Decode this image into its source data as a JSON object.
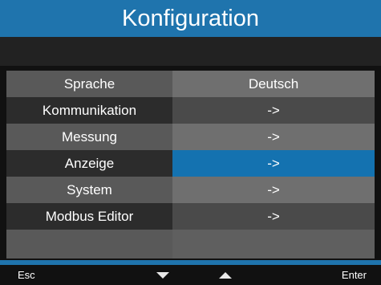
{
  "header": {
    "title": "Konfiguration"
  },
  "menu": {
    "items": [
      {
        "label": "Sprache",
        "value": "Deutsch"
      },
      {
        "label": "Kommunikation",
        "value": "->"
      },
      {
        "label": "Messung",
        "value": "->"
      },
      {
        "label": "Anzeige",
        "value": "->",
        "selected": true
      },
      {
        "label": "System",
        "value": "->"
      },
      {
        "label": "Modbus Editor",
        "value": "->"
      }
    ]
  },
  "footer": {
    "esc_label": "Esc",
    "enter_label": "Enter",
    "down_icon": "triangle-down",
    "up_icon": "triangle-up"
  },
  "colors": {
    "accent": "#1f74ad",
    "selected": "#1472b0"
  }
}
